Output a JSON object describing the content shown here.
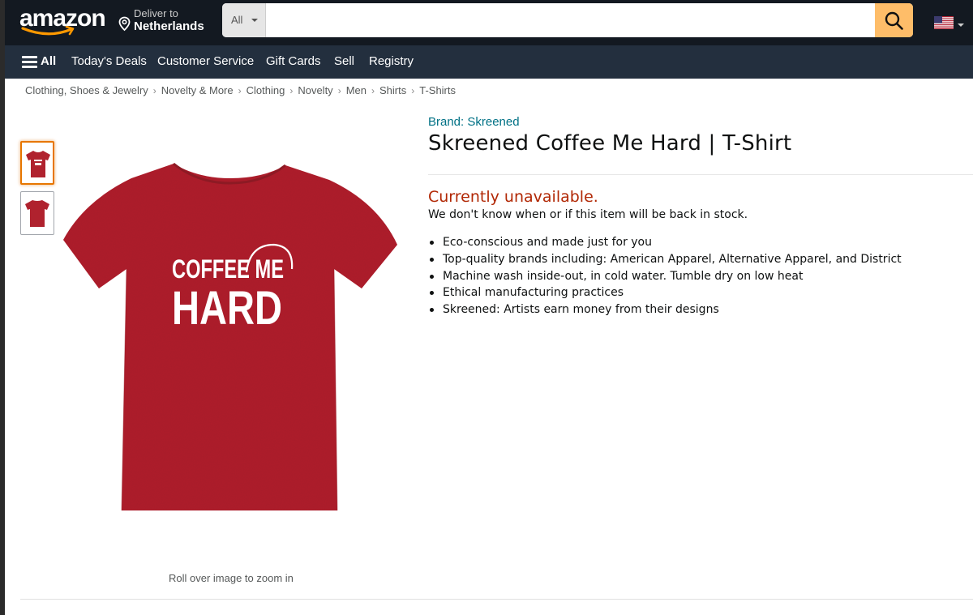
{
  "header": {
    "logo_text": "amazon",
    "deliver_label": "Deliver to",
    "deliver_location": "Netherlands",
    "search_category": "All",
    "search_placeholder": "",
    "search_value": "",
    "flag_icon": "us-flag-icon"
  },
  "subnav": {
    "all_label": "All",
    "items": [
      "Today's Deals",
      "Customer Service",
      "Gift Cards",
      "Sell",
      "Registry"
    ]
  },
  "breadcrumb": [
    "Clothing, Shoes & Jewelry",
    "Novelty & More",
    "Clothing",
    "Novelty",
    "Men",
    "Shirts",
    "T-Shirts"
  ],
  "product": {
    "brand": "Brand: Skreened",
    "title": "Skreened Coffee Me Hard | T-Shirt",
    "availability": "Currently unavailable.",
    "stock_note": "We don't know when or if this item will be back in stock.",
    "features": [
      "Eco-conscious and made just for you",
      "Top-quality brands including: American Apparel, Alternative Apparel, and District",
      "Machine wash inside-out, in cold water. Tumble dry on low heat",
      "Ethical manufacturing practices",
      "Skreened: Artists earn money from their designs"
    ],
    "shirt_print_line1": "COFFEE ME",
    "shirt_print_line2": "HARD",
    "zoom_hint": "Roll over image to zoom in",
    "shirt_color": "#b0222e"
  },
  "colors": {
    "nav_top": "#131921",
    "nav_sub": "#232f3e",
    "search_button": "#febd69",
    "link": "#007185",
    "unavailable": "#b12704"
  }
}
